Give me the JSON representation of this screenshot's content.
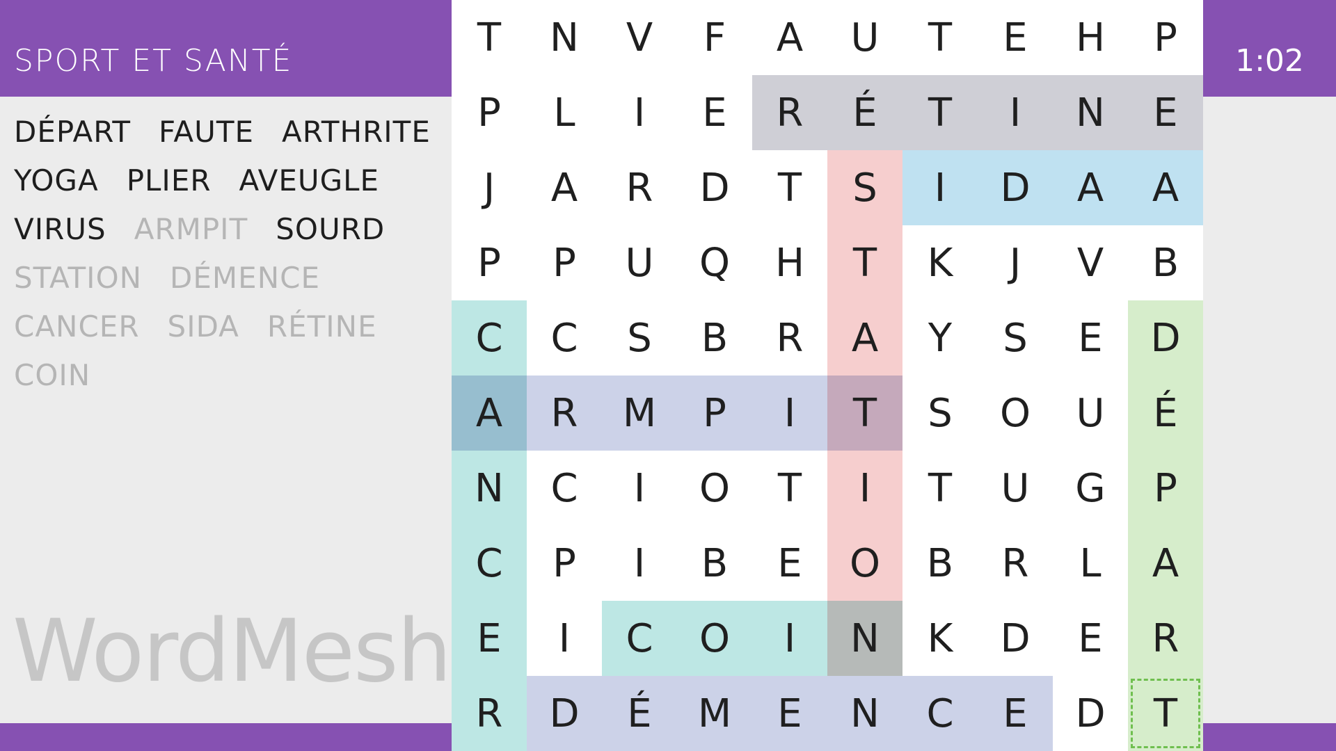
{
  "header": {
    "title": "SPORT ET SANTÉ",
    "timer": "1:02"
  },
  "words": [
    {
      "text": "DÉPART",
      "found": false
    },
    {
      "text": "FAUTE",
      "found": false
    },
    {
      "text": "ARTHRITE",
      "found": false
    },
    {
      "text": "YOGA",
      "found": false
    },
    {
      "text": "PLIER",
      "found": false
    },
    {
      "text": "AVEUGLE",
      "found": false
    },
    {
      "text": "VIRUS",
      "found": false
    },
    {
      "text": "ARMPIT",
      "found": true
    },
    {
      "text": "SOURD",
      "found": false
    },
    {
      "text": "STATION",
      "found": true
    },
    {
      "text": "DÉMENCE",
      "found": true
    },
    {
      "text": "CANCER",
      "found": true
    },
    {
      "text": "SIDA",
      "found": true
    },
    {
      "text": "RÉTINE",
      "found": true
    },
    {
      "text": "COIN",
      "found": true
    }
  ],
  "logo": "WordMesh",
  "colors": {
    "brand": "#8651b2",
    "found_word": "#b5b5b5",
    "cursor": "#6fbf4f"
  },
  "grid": [
    [
      "T",
      "N",
      "V",
      "F",
      "A",
      "U",
      "T",
      "E",
      "H",
      "P"
    ],
    [
      "P",
      "L",
      "I",
      "E",
      "R",
      "É",
      "T",
      "I",
      "N",
      "E"
    ],
    [
      "J",
      "A",
      "R",
      "D",
      "T",
      "S",
      "I",
      "D",
      "A",
      "A"
    ],
    [
      "P",
      "P",
      "U",
      "Q",
      "H",
      "T",
      "K",
      "J",
      "V",
      "B"
    ],
    [
      "C",
      "C",
      "S",
      "B",
      "R",
      "A",
      "Y",
      "S",
      "E",
      "D"
    ],
    [
      "A",
      "R",
      "M",
      "P",
      "I",
      "T",
      "S",
      "O",
      "U",
      "É"
    ],
    [
      "N",
      "C",
      "I",
      "O",
      "T",
      "I",
      "T",
      "U",
      "G",
      "P"
    ],
    [
      "C",
      "P",
      "I",
      "B",
      "E",
      "O",
      "B",
      "R",
      "L",
      "A"
    ],
    [
      "E",
      "I",
      "C",
      "O",
      "I",
      "N",
      "K",
      "D",
      "E",
      "R"
    ],
    [
      "R",
      "D",
      "É",
      "M",
      "E",
      "N",
      "C",
      "E",
      "D",
      "T"
    ]
  ],
  "found_highlights": [
    {
      "word": "RÉTINE",
      "row": 1,
      "col": 4,
      "dir": "across",
      "len": 6,
      "color": "#cfcfd6"
    },
    {
      "word": "STATION",
      "row": 2,
      "col": 5,
      "dir": "down",
      "len": 7,
      "color": "#f6cece"
    },
    {
      "word": "SIDA",
      "row": 2,
      "col": 6,
      "dir": "across",
      "len": 4,
      "color": "#bfe1f1"
    },
    {
      "word": "CANCER",
      "row": 4,
      "col": 0,
      "dir": "down",
      "len": 6,
      "color": "#bde7e4"
    },
    {
      "word": "ARMPIT",
      "row": 5,
      "col": 0,
      "dir": "across",
      "len": 6,
      "color": "#ccd2e8"
    },
    {
      "word": "COIN",
      "row": 8,
      "col": 2,
      "dir": "across",
      "len": 4,
      "color": "#bde7e4"
    },
    {
      "word": "DÉMENCE",
      "row": 9,
      "col": 1,
      "dir": "across",
      "len": 7,
      "color": "#ccd2e8"
    }
  ],
  "active_selection": {
    "row": 4,
    "col": 9,
    "dir": "down",
    "len": 6,
    "color": "#d6edcb"
  }
}
